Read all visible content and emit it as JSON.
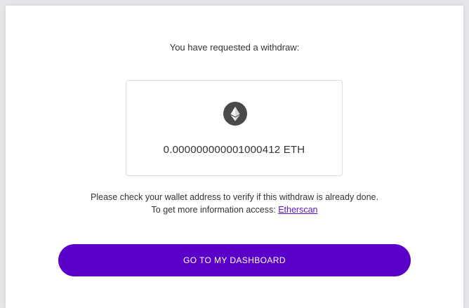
{
  "modal": {
    "heading": "You have requested a withdraw:",
    "amount_card": {
      "icon": "ethereum-icon",
      "amount": "0.000000000001000412 ETH"
    },
    "note": {
      "line1": "Please check your wallet address to verify if this withdraw is already done.",
      "line2_prefix": "To get more information access:",
      "link_label": "Etherscan"
    },
    "dashboard_button_label": "GO TO MY DASHBOARD"
  },
  "colors": {
    "accent": "#5a00c8",
    "link": "#5b15c7",
    "icon_background": "#4a4a4a",
    "text": "#333333"
  }
}
